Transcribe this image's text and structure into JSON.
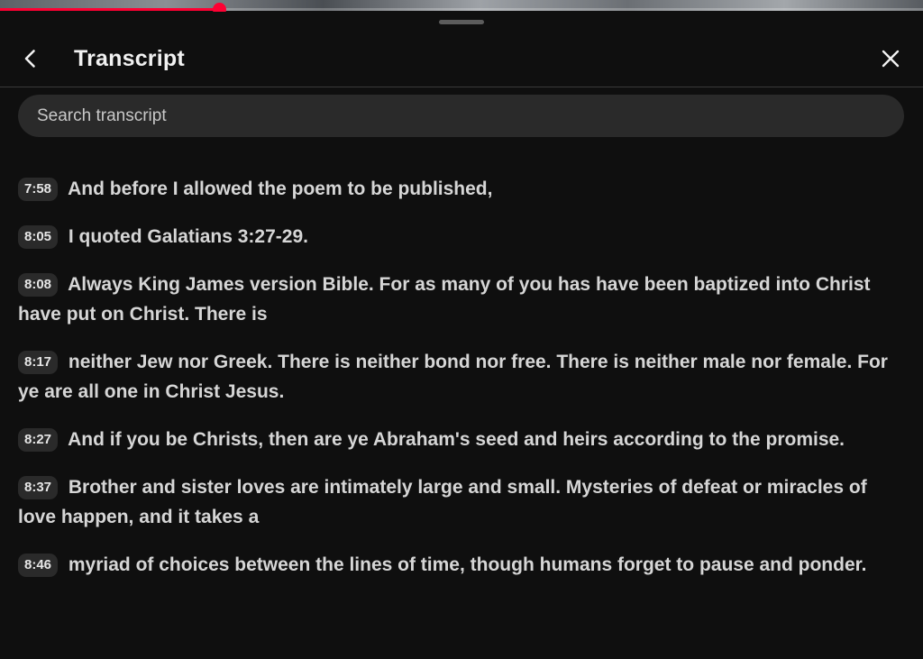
{
  "player": {
    "progress_percent": 23.7
  },
  "header": {
    "title": "Transcript",
    "back_icon": "chevron-left-icon",
    "close_icon": "close-icon"
  },
  "search": {
    "placeholder": "Search transcript",
    "value": ""
  },
  "segments": [
    {
      "time": "7:58",
      "text": "And before I allowed the poem to be published,"
    },
    {
      "time": "8:05",
      "text": "I quoted Galatians 3:27-29."
    },
    {
      "time": "8:08",
      "text": "Always King James version Bible. For as many of you has have been baptized into Christ have put on Christ. There is"
    },
    {
      "time": "8:17",
      "text": "neither Jew nor Greek. There is neither bond nor free. There is neither male nor female. For ye are all one in Christ Jesus."
    },
    {
      "time": "8:27",
      "text": "And if you be Christs, then are ye Abraham's seed and heirs according to the promise."
    },
    {
      "time": "8:37",
      "text": "Brother and sister loves are intimately large and small. Mysteries of defeat or miracles of love happen, and it takes a"
    },
    {
      "time": "8:46",
      "text": "myriad of choices between the lines of time, though humans forget to pause and ponder."
    }
  ],
  "colors": {
    "accent": "#ff0033",
    "background": "#0f0f0f",
    "chip": "#2a2a2a",
    "text": "#d6d6d6"
  }
}
